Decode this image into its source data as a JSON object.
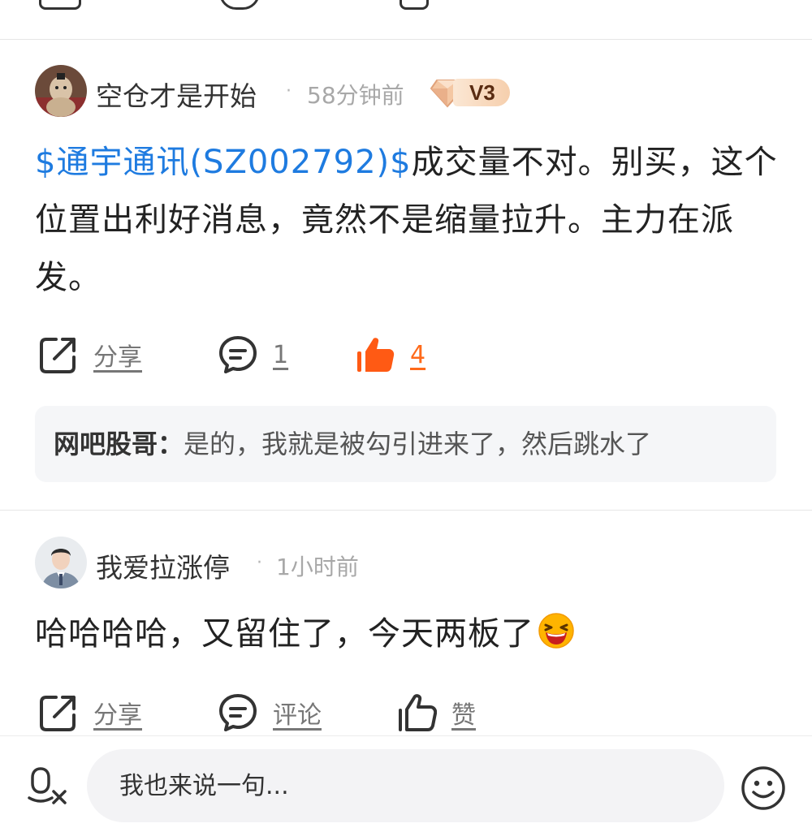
{
  "posts": [
    {
      "username": "空仓才是开始",
      "dot": "·",
      "time": "58分钟前",
      "vip_level": "V3",
      "content": {
        "stock_link": "$通宇通讯(SZ002792)$",
        "text": "成交量不对。别买，这个位置出利好消息，竟然不是缩量拉升。主力在派发。"
      },
      "actions": {
        "share": "分享",
        "comment": "1",
        "like": "4"
      },
      "reply": {
        "author": "网吧股哥：",
        "text": "是的，我就是被勾引进来了，然后跳水了"
      }
    },
    {
      "username": "我爱拉涨停",
      "dot": "·",
      "time": "1小时前",
      "content": {
        "text": "哈哈哈哈，又留住了，今天两板了"
      },
      "actions": {
        "share": "分享",
        "comment": "评论",
        "like": "赞"
      }
    }
  ],
  "input": {
    "placeholder": "我也来说一句..."
  },
  "colors": {
    "link": "#1e7be0",
    "like_active": "#ff6a1a",
    "muted": "#a8a8a8"
  },
  "icons": {
    "share": "share-icon",
    "comment": "comment-icon",
    "like": "thumbs-up-icon",
    "voice": "voice-to-text-icon",
    "emoji": "emoji-icon"
  }
}
